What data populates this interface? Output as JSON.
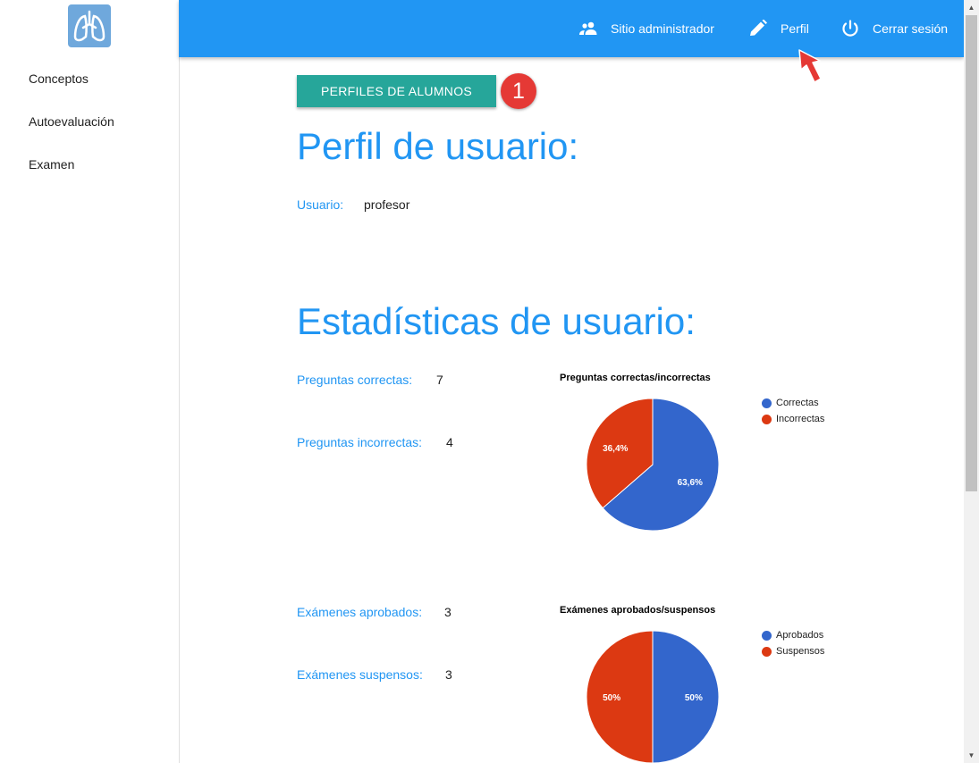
{
  "sidebar": {
    "items": [
      {
        "label": "Conceptos"
      },
      {
        "label": "Autoevaluación"
      },
      {
        "label": "Examen"
      }
    ]
  },
  "header": {
    "admin_label": "Sitio administrador",
    "profile_label": "Perfil",
    "logout_label": "Cerrar sesión",
    "color": "#2196f3"
  },
  "main": {
    "profiles_button": "PERFILES DE ALUMNOS",
    "step_badge": "1",
    "profile_title": "Perfil de usuario:",
    "user_label": "Usuario:",
    "user_value": "profesor",
    "stats_title": "Estadísticas de usuario:",
    "stats": [
      {
        "label": "Preguntas correctas:",
        "value": "7"
      },
      {
        "label": "Preguntas incorrectas:",
        "value": "4"
      },
      {
        "label": "Exámenes aprobados:",
        "value": "3"
      },
      {
        "label": "Exámenes suspensos:",
        "value": "3"
      }
    ]
  },
  "chart_data": [
    {
      "type": "pie",
      "title": "Preguntas correctas/incorrectas",
      "categories": [
        "Correctas",
        "Incorrectas"
      ],
      "values": [
        63.6,
        36.4
      ],
      "labels": [
        "63,6%",
        "36,4%"
      ],
      "colors": [
        "#3366cc",
        "#dc3912"
      ],
      "legend": "right"
    },
    {
      "type": "pie",
      "title": "Exámenes aprobados/suspensos",
      "categories": [
        "Aprobados",
        "Suspensos"
      ],
      "values": [
        50,
        50
      ],
      "labels": [
        "50%",
        "50%"
      ],
      "colors": [
        "#3366cc",
        "#dc3912"
      ],
      "legend": "right"
    }
  ]
}
